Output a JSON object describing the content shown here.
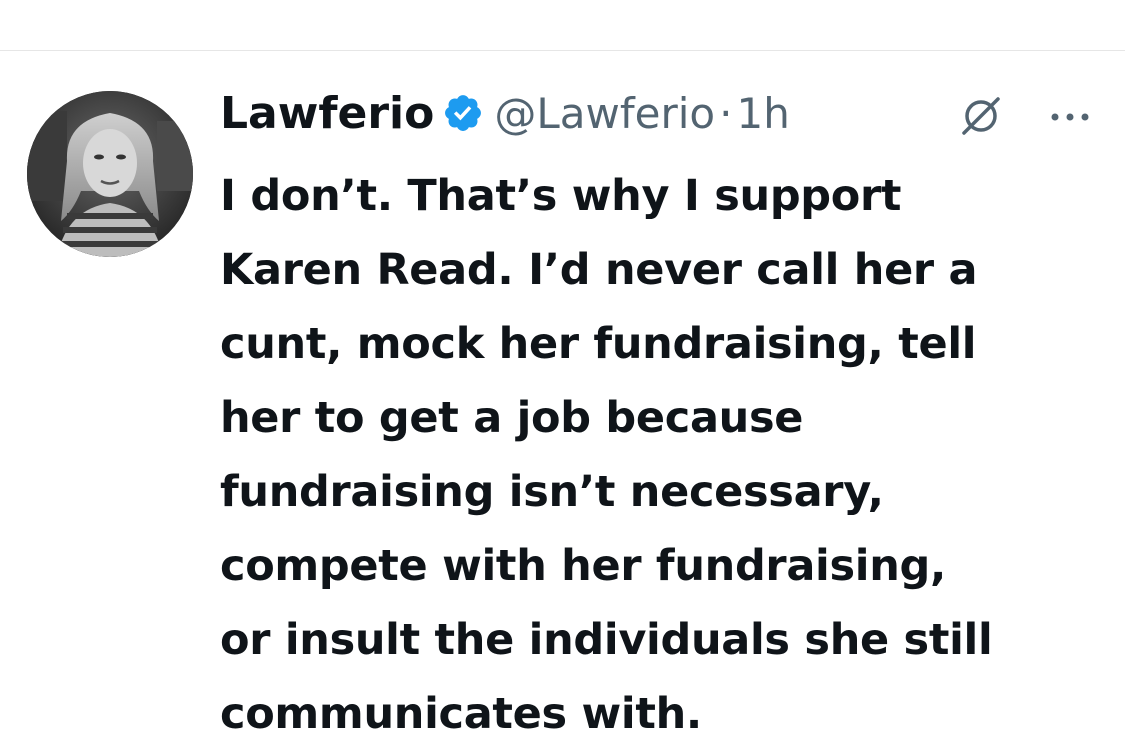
{
  "tweet": {
    "author": {
      "display_name": "Lawferio",
      "verified": true,
      "handle": "@Lawferio",
      "avatar_icon": "profile-photo"
    },
    "separator": "·",
    "timestamp": "1h",
    "text_lines": [
      "I don’t. That’s why I support",
      "Karen Read. I’d never call her a",
      "cunt, mock her fundraising, tell",
      "her to get a job because",
      "fundraising isn’t necessary,",
      "compete with her fundraising,",
      "or insult the individuals she still",
      "communicates with."
    ],
    "icons": {
      "verified": "verified-badge-icon",
      "grok": "grok-icon",
      "more": "more-options-icon"
    }
  },
  "colors": {
    "text_primary": "#0f1419",
    "text_secondary": "#536471",
    "verified_blue": "#1d9bf0",
    "divider": "#e6e6e6",
    "background": "#ffffff"
  }
}
